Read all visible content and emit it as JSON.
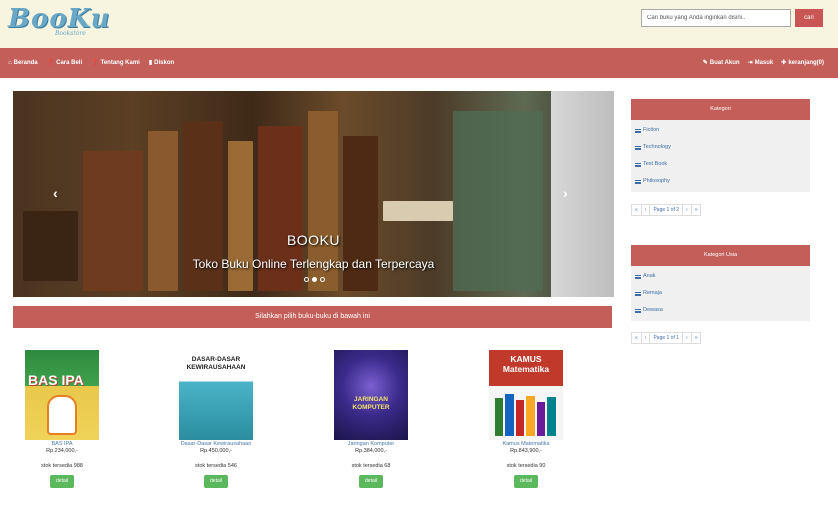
{
  "header": {
    "logo_text": "BooKu",
    "logo_sub": "Bookstore",
    "search_placeholder": "Cari buku yang Anda inginkan disini..",
    "search_button": "cari"
  },
  "nav": {
    "left": [
      {
        "label": "Beranda",
        "icon": "home-icon"
      },
      {
        "label": "Cara Beli",
        "icon": "question-circle-icon"
      },
      {
        "label": "Tentang Kami",
        "icon": "question-circle-icon"
      },
      {
        "label": "Diskon",
        "icon": "book-icon"
      }
    ],
    "right": [
      {
        "label": "Buat Akun",
        "icon": "pencil-icon"
      },
      {
        "label": "Masuk",
        "icon": "login-icon"
      },
      {
        "label": "keranjang(0)",
        "icon": "plus-icon"
      }
    ]
  },
  "carousel": {
    "title": "BOOKU",
    "caption": "Toko Buku Online Terlengkap dan Terpercaya",
    "prev_icon": "chevron-left-icon",
    "next_icon": "chevron-right-icon",
    "slide_count": 3,
    "active_slide": 2
  },
  "banner": "Silahkan pilih buku-buku di bawah ini",
  "products": [
    {
      "title": "BAS IPA",
      "price": "Rp.234,000,-",
      "stock": "stok tersedia 988",
      "button": "detail",
      "cover_text": "BAS IPA"
    },
    {
      "title": "Dasar-Dasar Kewirausahaan",
      "price": "Rp.450,000,-",
      "stock": "stok tersedia 546",
      "button": "detail",
      "cover_text": "DASAR-DASAR KEWIRAUSAHAAN"
    },
    {
      "title": "Jaringan Komputer",
      "price": "Rp.384,000,-",
      "stock": "stok tersedia 68",
      "button": "detail",
      "cover_text": "JARINGAN KOMPUTER"
    },
    {
      "title": "Kamus Matematika",
      "price": "Rp.843,900,-",
      "stock": "stok tersedia 90",
      "button": "detail",
      "cover_text": "KAMUS Matematika"
    }
  ],
  "kategori": {
    "title": "Kategori",
    "items": [
      "Fiction",
      "Technology",
      "Text Book",
      "Philosophy"
    ],
    "pager": [
      "«",
      "‹",
      "Page 1 of 2",
      "›",
      "»"
    ]
  },
  "kategori_usia": {
    "title": "Kategori Usia",
    "items": [
      "Anak",
      "Remaja",
      "Dewasa"
    ],
    "pager": [
      "«",
      "‹",
      "Page 1 of 1",
      "›",
      "»"
    ]
  },
  "colors": {
    "brand_red": "#c35e58",
    "header_bg": "#f7f5e0",
    "button_green": "#5cb85c",
    "link_blue": "#3d6ea8"
  }
}
